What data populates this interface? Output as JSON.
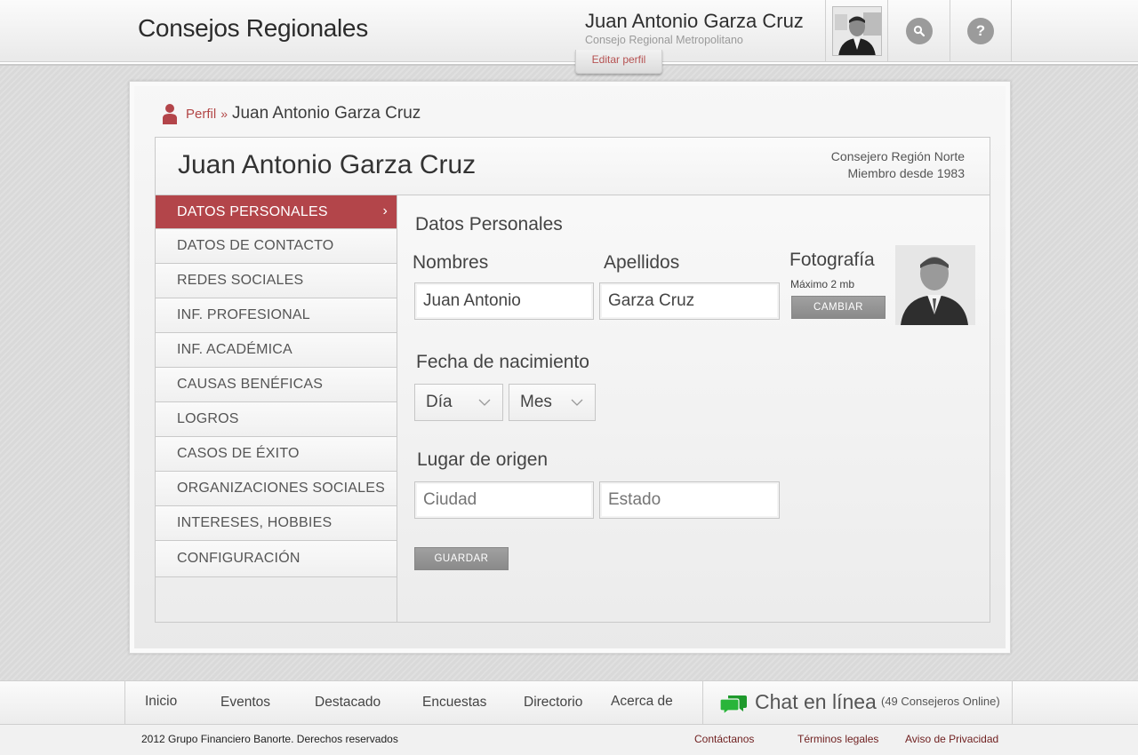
{
  "header": {
    "app_title": "Consejos Regionales",
    "user_name": "Juan Antonio Garza Cruz",
    "user_council": "Consejo Regional Metropolitano",
    "edit_profile": "Editar perfil",
    "search_icon": "search-icon",
    "help_label": "?"
  },
  "breadcrumb": {
    "link": "Perfil",
    "separator": "»",
    "current": "Juan Antonio Garza Cruz"
  },
  "profile": {
    "name": "Juan Antonio Garza Cruz",
    "role": "Consejero Región Norte",
    "member_since": "Miembro desde 1983"
  },
  "menu": {
    "items": [
      {
        "label": "DATOS PERSONALES",
        "active": true
      },
      {
        "label": "DATOS DE CONTACTO"
      },
      {
        "label": "REDES SOCIALES"
      },
      {
        "label": "INF. PROFESIONAL"
      },
      {
        "label": "INF. ACADÉMICA"
      },
      {
        "label": "CAUSAS BENÉFICAS"
      },
      {
        "label": "LOGROS"
      },
      {
        "label": "CASOS DE ÉXITO"
      },
      {
        "label": "ORGANIZACIONES SOCIALES"
      },
      {
        "label": "INTERESES, HOBBIES"
      },
      {
        "label": "CONFIGURACIÓN"
      }
    ],
    "active_chevron": "›"
  },
  "form": {
    "section_title": "Datos Personales",
    "nombres_label": "Nombres",
    "nombres_value": "Juan Antonio",
    "apellidos_label": "Apellidos",
    "apellidos_value": "Garza Cruz",
    "foto_label": "Fotografía",
    "foto_hint": "Máximo 2 mb",
    "cambiar_label": "CAMBIAR",
    "fecha_label": "Fecha de nacimiento",
    "dia_value": "Día",
    "mes_value": "Mes",
    "lugar_label": "Lugar de origen",
    "ciudad_placeholder": "Ciudad",
    "estado_placeholder": "Estado",
    "guardar_label": "GUARDAR"
  },
  "footer_nav": {
    "links": [
      "Inicio",
      "Eventos",
      "Destacado",
      "Encuestas",
      "Directorio",
      "Acerca de"
    ],
    "chat_label": "Chat en línea",
    "chat_count": "(49 Consejeros Online)",
    "chat_icon_color": "#1e9a2c"
  },
  "footer": {
    "copyright": "2012 Grupo Financiero Banorte. Derechos reservados",
    "links": [
      "Contáctanos",
      "Términos legales",
      "Aviso de Privacidad"
    ]
  },
  "colors": {
    "accent": "#b3454a",
    "link": "#b24646",
    "button_gray": "#999999"
  }
}
